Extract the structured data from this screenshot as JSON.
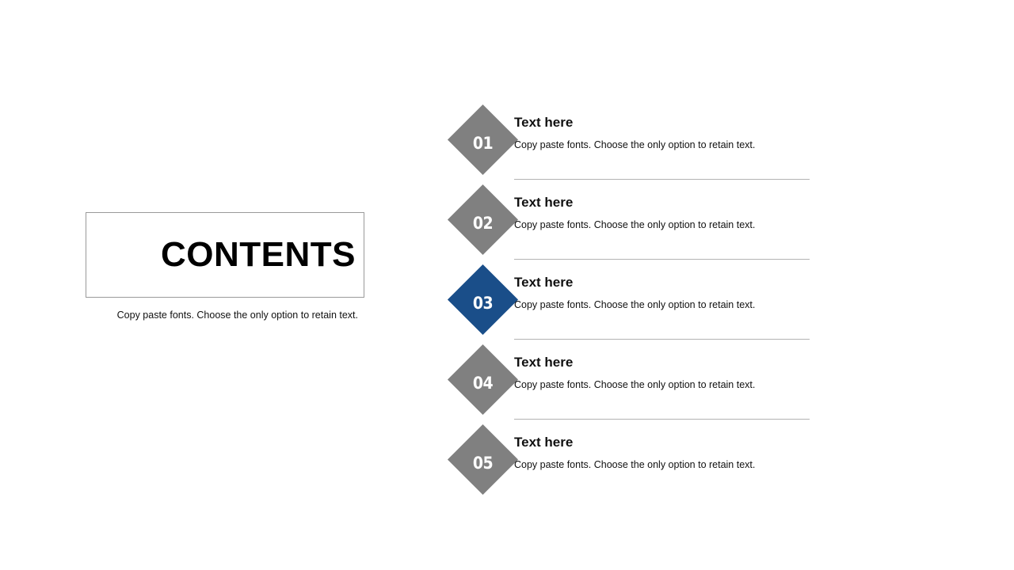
{
  "left": {
    "title": "CONTENTS",
    "subtitle": "Copy paste fonts. Choose the only option to retain text."
  },
  "colors": {
    "accent": "#1a4e89",
    "neutral": "#808080",
    "divider": "#b3b3b3",
    "box_border": "#9a9a9a",
    "text": "#111111"
  },
  "items": [
    {
      "number": "01",
      "heading": "Text here",
      "description": "Copy paste fonts. Choose the only option to retain text.",
      "highlighted": false,
      "divider_after": true
    },
    {
      "number": "02",
      "heading": "Text here",
      "description": "Copy paste fonts. Choose the only option to retain text.",
      "highlighted": false,
      "divider_after": true
    },
    {
      "number": "03",
      "heading": "Text here",
      "description": "Copy paste fonts. Choose the only option to retain text.",
      "highlighted": true,
      "divider_after": true
    },
    {
      "number": "04",
      "heading": "Text here",
      "description": "Copy paste fonts. Choose the only option to retain text.",
      "highlighted": false,
      "divider_after": true
    },
    {
      "number": "05",
      "heading": "Text here",
      "description": "Copy paste fonts. Choose the only option to retain text.",
      "highlighted": false,
      "divider_after": false
    }
  ]
}
